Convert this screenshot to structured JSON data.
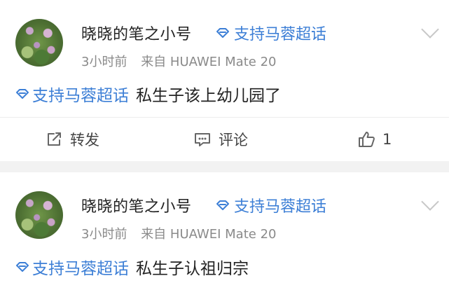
{
  "posts": [
    {
      "username": "晓晓的笔之小号",
      "super_topic": "支持马蓉超话",
      "time": "3小时前",
      "source": "来自 HUAWEI Mate 20",
      "hashtag": "支持马蓉超话",
      "text": "私生子该上幼儿园了",
      "actions": {
        "repost_label": "转发",
        "comment_label": "评论",
        "like_count": "1"
      }
    },
    {
      "username": "晓晓的笔之小号",
      "super_topic": "支持马蓉超话",
      "time": "3小时前",
      "source": "来自 HUAWEI Mate 20",
      "hashtag": "支持马蓉超话",
      "text": "私生子认祖归宗"
    }
  ],
  "colors": {
    "link": "#3d7fd6",
    "meta": "#8a8a8a",
    "separator": "#f2f2f2"
  },
  "icons": {
    "super_topic": "diamond-icon",
    "repost": "share-out-icon",
    "comment": "comment-icon",
    "like": "thumbs-up-icon",
    "more": "chevron-down-icon"
  }
}
